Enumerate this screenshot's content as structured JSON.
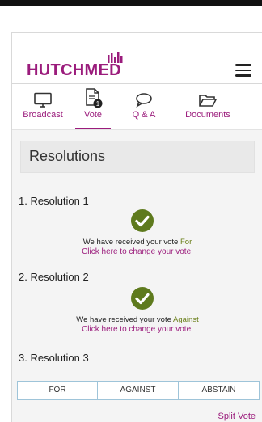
{
  "header": {
    "logo_text": "HUTCHMED"
  },
  "tabs": [
    {
      "label": "Broadcast",
      "icon": "monitor-icon"
    },
    {
      "label": "Vote",
      "icon": "document-icon",
      "badge": "1"
    },
    {
      "label": "Q & A",
      "icon": "speech-bubble-icon"
    },
    {
      "label": "Documents",
      "icon": "folder-icon"
    }
  ],
  "panel": {
    "title": "Resolutions"
  },
  "resolutions": [
    {
      "title": "1. Resolution 1",
      "received_text": "We have received your vote",
      "vote": "For",
      "change_link": "Click here to change your vote."
    },
    {
      "title": "2. Resolution 2",
      "received_text": "We have received your vote",
      "vote": "Against",
      "change_link": "Click here to change your vote."
    },
    {
      "title": "3. Resolution 3",
      "options": [
        "FOR",
        "AGAINST",
        "ABSTAIN"
      ],
      "split_vote": "Split Vote"
    }
  ],
  "colors": {
    "brand": "#9b1c7c",
    "check": "#5e7a1d",
    "vote_value": "#6a7f1a"
  }
}
